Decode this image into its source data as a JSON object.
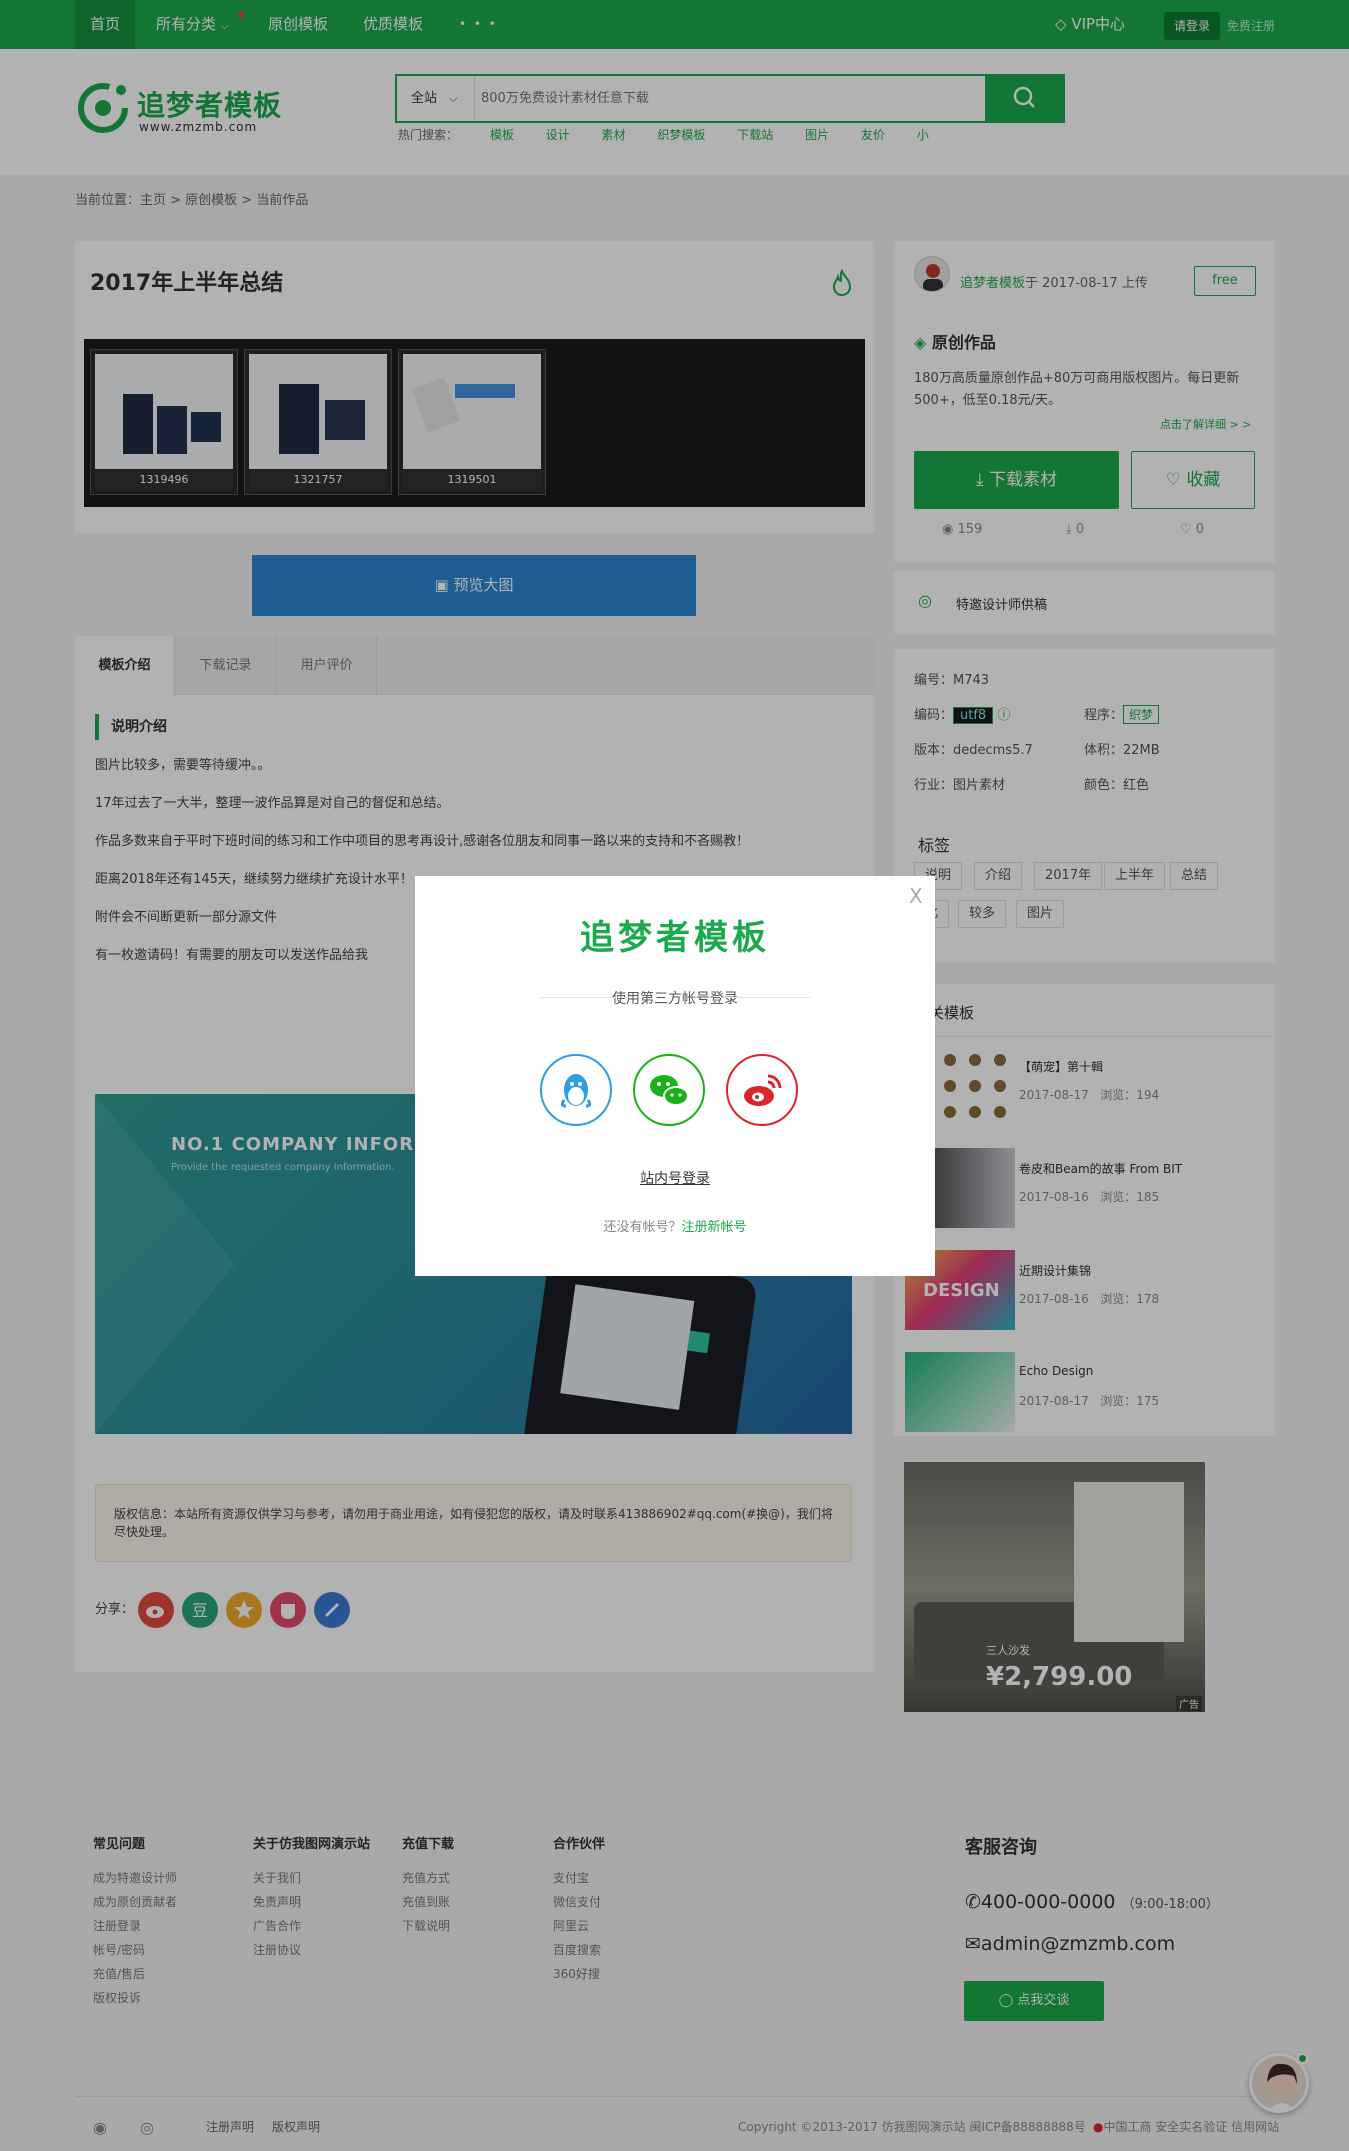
{
  "nav": {
    "items": [
      "首页",
      "所有分类",
      "原创模板",
      "优质模板",
      "• • •"
    ],
    "vip": "VIP中心",
    "login": "请登录",
    "register": "免费注册"
  },
  "header": {
    "logo_text": "追梦者模板",
    "logo_sub": "www.zmzmb.com",
    "search_scope": "全站",
    "search_placeholder": "800万免费设计素材任意下载",
    "hot_label": "热门搜索：",
    "hot_tags": [
      "模板",
      "设计",
      "素材",
      "织梦模板",
      "下载站",
      "图片",
      "友价",
      "小"
    ]
  },
  "breadcrumb": "当前位置：主页 > 原创模板 > 当前作品",
  "work": {
    "title": "2017年上半年总结",
    "thumbs": [
      "1319496",
      "1321757",
      "1319501"
    ],
    "preview_btn": "预览大图",
    "tabs": [
      "模板介绍",
      "下载记录",
      "用户评价"
    ],
    "section_head": "说明介绍",
    "paras": [
      "图片比较多，需要等待缓冲。。",
      "17年过去了一大半，整理一波作品算是对自己的督促和总结。",
      "作品多数来自于平时下班时间的练习和工作中项目的思考再设计,感谢各位朋友和同事一路以来的支持和不吝赐教！",
      "距离2018年还有145天，继续努力继续扩充设计水平！",
      "附件会不间断更新一部分源文件",
      "有一枚邀请码！有需要的朋友可以发送作品给我"
    ],
    "banner_title": "NO.1 COMPANY INFORMAT",
    "banner_sub": "Provide the requested company information.",
    "copyright": "版权信息：本站所有资源仅供学习与参考，请勿用于商业用途，如有侵犯您的版权，请及时联系413886902#qq.com(#换@)，我们将尽快处理。",
    "share_label": "分享："
  },
  "sidebar": {
    "uploader_name": "追梦者模板",
    "uploader_text": "于 2017-08-17 上传",
    "free": "free",
    "orig_head": "原创作品",
    "orig_desc": "180万高质量原创作品+80万可商用版权图片。每日更新 500+，低至0.18元/天。",
    "more_link": "点击了解详细 > >",
    "download_btn": "下载素材",
    "fav_btn": "收藏",
    "views": "159",
    "downloads": "0",
    "likes": "0",
    "designer": "特邀设计师供稿",
    "meta": {
      "id": "编号：M743",
      "encoding_label": "编码：",
      "encoding": "utf8",
      "program_label": "程序：",
      "program": "织梦",
      "version": "版本：dedecms5.7",
      "size": "体积：22MB",
      "industry": "行业：图片素材",
      "color": "颜色：红色"
    },
    "tags_head": "标签",
    "tags": [
      "说明",
      "介绍",
      "2017年",
      "上半年",
      "总结",
      "化",
      "较多",
      "图片"
    ],
    "related_head": "相关模板",
    "related": [
      {
        "title": "【萌宠】第十輯",
        "date": "2017-08-17",
        "views": "浏览：194"
      },
      {
        "title": "卷皮和Beam的故事 From BIT",
        "date": "2017-08-16",
        "views": "浏览：185"
      },
      {
        "title": "近期设计集锦",
        "date": "2017-08-16",
        "views": "浏览：178"
      },
      {
        "title": "Echo Design",
        "date": "2017-08-17",
        "views": "浏览：175"
      }
    ],
    "ad_price": "¥2,799.00",
    "ad_text": "三人沙发",
    "ad_tag": "广告"
  },
  "footer": {
    "cols": [
      {
        "head": "常见问题",
        "items": [
          "成为特邀设计师",
          "成为原创贡献者",
          "注册登录",
          "帐号/密码",
          "充值/售后",
          "版权投诉"
        ]
      },
      {
        "head": "关于仿我图网演示站",
        "items": [
          "关于我们",
          "免责声明",
          "广告合作",
          "注册协议"
        ]
      },
      {
        "head": "充值下载",
        "items": [
          "充值方式",
          "充值到账",
          "下载说明"
        ]
      },
      {
        "head": "合作伙伴",
        "items": [
          "支付宝",
          "微信支付",
          "阿里云",
          "百度搜索",
          "360好搜"
        ]
      }
    ],
    "service_head": "客服咨询",
    "phone": "400-000-0000",
    "hours": "（9:00-18:00）",
    "email": "admin@zmzmb.com",
    "chat_btn": "点我交谈",
    "links": [
      "注册声明",
      "版权声明"
    ],
    "copyright": "Copyright ©2013-2017 仿我图网演示站 闽ICP备88888888号",
    "badges": "中国工商 安全实名验证 信用网站"
  },
  "modal": {
    "close": "X",
    "title": "追梦者模板",
    "subtitle": "使用第三方帐号登录",
    "site_login": "站内号登录",
    "no_account": "还没有帐号？",
    "register": "注册新帐号"
  },
  "colors": {
    "brand": "#1ca94c",
    "preview": "#2e86d6",
    "qq": "#2d9ee0",
    "wechat": "#1ab21a",
    "weibo": "#d9252b"
  }
}
